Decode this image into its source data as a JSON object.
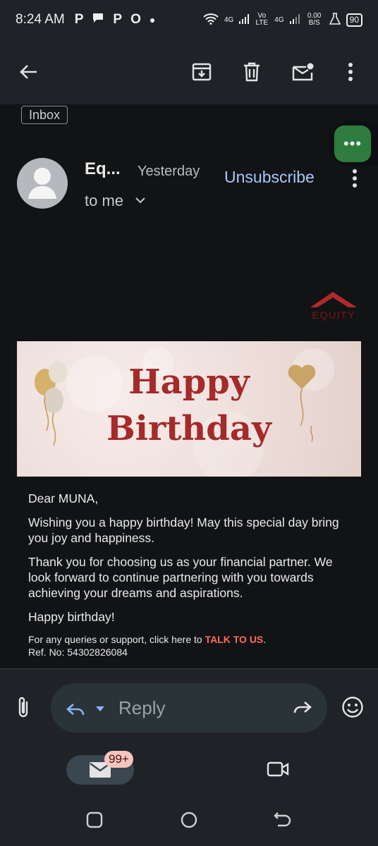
{
  "status_bar": {
    "time": "8:24 AM",
    "notif_icons": [
      "P",
      "P",
      "O"
    ],
    "network1": "4G",
    "volte": "Vo LTE",
    "network2": "4G",
    "data_rate": "0.00 B/S",
    "battery": "90"
  },
  "email": {
    "label": "Inbox",
    "sender": "Eq...",
    "date": "Yesterday",
    "recipient": "to me",
    "unsubscribe": "Unsubscribe",
    "logo_text": "EQUITY",
    "banner_line1": "Happy",
    "banner_line2": "Birthday",
    "greeting": "Dear MUNA,",
    "para1": "Wishing you a happy birthday! May this special day bring you joy and happiness.",
    "para2": "Thank you for choosing us as your financial partner. We look forward to continue partnering with you towards achieving your dreams and aspirations.",
    "para3": "Happy birthday!",
    "support_text": "For any queries or support, click here to",
    "talk_link": "TALK TO US",
    "period": ".",
    "ref": "Ref. No: 54302826084"
  },
  "reply_bar": {
    "placeholder": "Reply"
  },
  "bottom_nav": {
    "mail_badge": "99+"
  },
  "colors": {
    "accent_link": "#a8c7fa",
    "talk_link": "#ff6b5a",
    "banner_text": "#a52a2a",
    "fab": "#2f7d3e"
  }
}
